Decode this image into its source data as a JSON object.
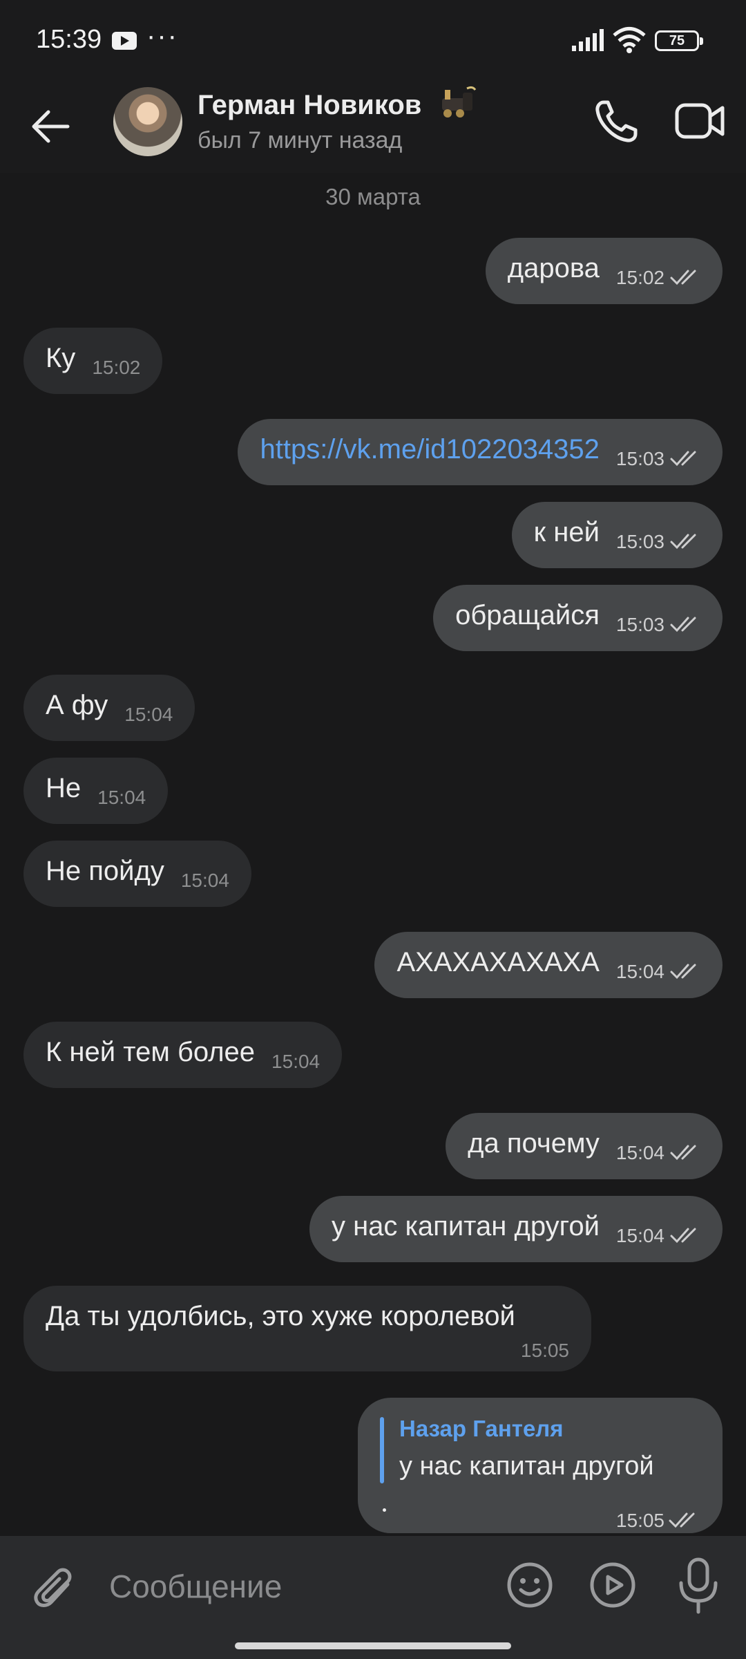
{
  "status_bar": {
    "time": "15:39",
    "battery": "75"
  },
  "header": {
    "name": "Герман Новиков",
    "status": "был 7 минут назад"
  },
  "date_separator": "30 марта",
  "messages": [
    {
      "text": "дарова",
      "time": "15:02"
    },
    {
      "text": "Ку",
      "time": "15:02"
    },
    {
      "text": "https://vk.me/id1022034352",
      "time": "15:03"
    },
    {
      "text": "к ней",
      "time": "15:03"
    },
    {
      "text": "обращайся",
      "time": "15:03"
    },
    {
      "text": "А фу",
      "time": "15:04"
    },
    {
      "text": "Не",
      "time": "15:04"
    },
    {
      "text": "Не пойду",
      "time": "15:04"
    },
    {
      "text": "АХАХАХАХАХА",
      "time": "15:04"
    },
    {
      "text": "К ней тем более",
      "time": "15:04"
    },
    {
      "text": "да почему",
      "time": "15:04"
    },
    {
      "text": "у нас капитан другой",
      "time": "15:04"
    },
    {
      "text": "Да ты удолбись, это хуже королевой",
      "time": "15:05"
    }
  ],
  "reply_message": {
    "quoted_name": "Назар Гантеля",
    "quoted_text": "у нас капитан другой",
    "time": "15:05"
  },
  "composer": {
    "placeholder": "Сообщение"
  },
  "colors": {
    "accent": "#5ea1ee",
    "outgoing_bubble": "#454749",
    "incoming_bubble": "#2b2c2e",
    "background": "#19191a"
  }
}
